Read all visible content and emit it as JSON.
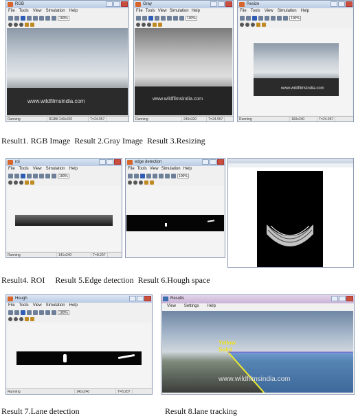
{
  "menu": [
    "File",
    "Tools",
    "View",
    "Simulation",
    "Help"
  ],
  "zoom": "100%",
  "watermark": "www.wildfilmsindia.com",
  "windows": {
    "rgb": {
      "title": "RGB",
      "status": [
        "Running",
        "RGB8 240x320",
        "T=24.957"
      ]
    },
    "gray": {
      "title": "Gray",
      "status": [
        "Running",
        "240x320",
        "T=24.957"
      ]
    },
    "resize": {
      "title": "Resize",
      "status": [
        "Running",
        "160x240",
        "T=24.957"
      ]
    },
    "roi": {
      "title": "roi",
      "status": [
        "Running",
        "141x240",
        "T=8.207"
      ]
    },
    "edge": {
      "title": "edge detection",
      "status": []
    },
    "hough_space": {
      "title": "",
      "status": []
    },
    "hough": {
      "title": "Hough",
      "status": [
        "Running",
        "141x240",
        "T=8.207"
      ]
    },
    "results": {
      "title": "Results",
      "menu": [
        "View",
        "Settings",
        "Help"
      ],
      "lane_labels": [
        "Yellow",
        "Solid"
      ]
    }
  },
  "captions": {
    "row1": "Result1. RGB Image  Result 2.Gray Image  Result 3.Resizing",
    "row2": "Result4. ROI     Result 5.Edge detection  Result 6.Hough space",
    "row3_left": "Result 7.Lane detection",
    "row3_right": "Result 8.lane tracking"
  }
}
